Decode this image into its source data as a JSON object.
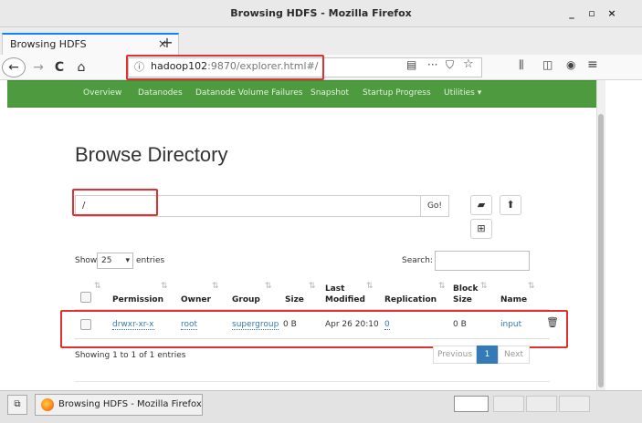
{
  "window": {
    "title": "Browsing HDFS - Mozilla Firefox",
    "minimize": "_",
    "maximize": "▫",
    "close": "×"
  },
  "tab": {
    "label": "Browsing HDFS",
    "close": "×",
    "new_tab": "+"
  },
  "nav": {
    "back": "←",
    "forward": "→",
    "reload": "C",
    "home": "⌂",
    "info": "ⓘ",
    "url_host": "hadoop102",
    "url_rest": ":9870/explorer.html#/",
    "page_actions": "···",
    "menu": "≡"
  },
  "hadoop_nav": {
    "items": [
      "Overview",
      "Datanodes",
      "Datanode Volume Failures",
      "Snapshot",
      "Startup Progress",
      "Utilities ▾"
    ]
  },
  "page": {
    "title": "Browse Directory",
    "path_value": "/",
    "go_label": "Go!",
    "show_label": "Show",
    "entries_value": "25",
    "entries_label": "entries",
    "search_label": "Search:",
    "search_value": ""
  },
  "table": {
    "headers": {
      "permission": "Permission",
      "owner": "Owner",
      "group": "Group",
      "size": "Size",
      "last_modified_1": "Last",
      "last_modified_2": "Modified",
      "replication": "Replication",
      "block_size_1": "Block",
      "block_size_2": "Size",
      "name": "Name"
    },
    "rows": [
      {
        "permission": "drwxr-xr-x",
        "owner": "root",
        "group": "supergroup",
        "size": "0 B",
        "last_modified": "Apr 26 20:10",
        "replication": "0",
        "block_size": "0 B",
        "name": "input"
      }
    ]
  },
  "footer": {
    "showing": "Showing 1 to 1 of 1 entries",
    "previous": "Previous",
    "page": "1",
    "next": "Next"
  },
  "taskbar": {
    "window_label": "Browsing HDFS - Mozilla Firefox"
  },
  "colors": {
    "hadoop_nav": "#4d9a3f",
    "link": "#337ab7",
    "annotation": "#e03030"
  },
  "icons": [
    "folder-open-icon",
    "upload-icon",
    "table-icon",
    "trash-icon",
    "sort-icon",
    "firefox-icon"
  ]
}
